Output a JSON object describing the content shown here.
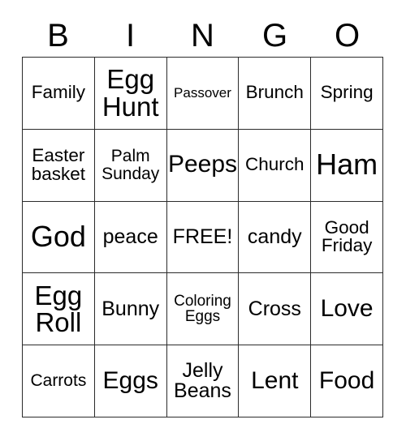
{
  "card": {
    "title": "BINGO",
    "columns": [
      "B",
      "I",
      "N",
      "G",
      "O"
    ],
    "free_space_label": "FREE!",
    "colors": {
      "background": "#ffffff",
      "border": "#2b2b2b",
      "text": "#000000"
    },
    "grid_size": "5x5",
    "rows": [
      [
        {
          "label": "Family",
          "size": "ml"
        },
        {
          "label": "Egg\nHunt",
          "size": "xxl"
        },
        {
          "label": "Passover",
          "size": "xs"
        },
        {
          "label": "Brunch",
          "size": "ml"
        },
        {
          "label": "Spring",
          "size": "ml"
        }
      ],
      [
        {
          "label": "Easter\nbasket",
          "size": "ml"
        },
        {
          "label": "Palm\nSunday",
          "size": "m"
        },
        {
          "label": "Peeps",
          "size": "xl"
        },
        {
          "label": "Church",
          "size": "ml"
        },
        {
          "label": "Ham",
          "size": "xxxl"
        }
      ],
      [
        {
          "label": "God",
          "size": "xxxl"
        },
        {
          "label": "peace",
          "size": "l"
        },
        {
          "label": "FREE!",
          "size": "l"
        },
        {
          "label": "candy",
          "size": "l"
        },
        {
          "label": "Good\nFriday",
          "size": "ml"
        }
      ],
      [
        {
          "label": "Egg\nRoll",
          "size": "xxl"
        },
        {
          "label": "Bunny",
          "size": "l"
        },
        {
          "label": "Coloring\nEggs",
          "size": "s"
        },
        {
          "label": "Cross",
          "size": "l"
        },
        {
          "label": "Love",
          "size": "xl"
        }
      ],
      [
        {
          "label": "Carrots",
          "size": "m"
        },
        {
          "label": "Eggs",
          "size": "xl"
        },
        {
          "label": "Jelly\nBeans",
          "size": "l"
        },
        {
          "label": "Lent",
          "size": "xl"
        },
        {
          "label": "Food",
          "size": "xl"
        }
      ]
    ]
  }
}
